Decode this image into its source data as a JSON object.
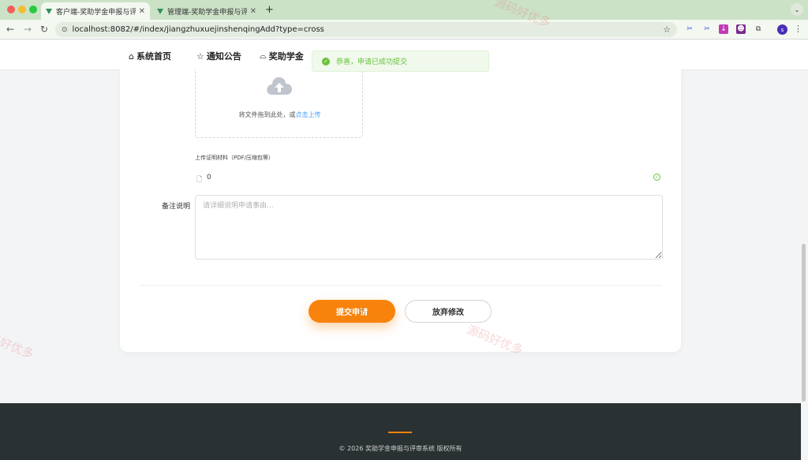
{
  "browser": {
    "tabs": [
      {
        "title": "客户端-奖助学金申报与评审系统",
        "active": true
      },
      {
        "title": "管理端-奖助学金申报与评审系统",
        "active": false
      }
    ],
    "url": "localhost:8082/#/index/jiangzhuxuejinshenqingAdd?type=cross",
    "profile_initial": "s"
  },
  "nav": {
    "items": [
      {
        "label": "系统首页",
        "icon": "home-icon"
      },
      {
        "label": "通知公告",
        "icon": "star-icon"
      },
      {
        "label": "奖助学金",
        "icon": "bag-icon"
      }
    ]
  },
  "toast": {
    "message": "恭喜，申请已成功提交",
    "type": "success"
  },
  "upload": {
    "hint": "将文件拖到此处，或",
    "link": "点击上传",
    "tip": "上传证明材料（PDF/压缩包等）",
    "file_name": "0"
  },
  "form": {
    "remark_label": "备注说明",
    "remark_placeholder": "请详细说明申请事由...",
    "remark_value": ""
  },
  "actions": {
    "submit_label": "提交申请",
    "cancel_label": "放弃修改"
  },
  "watermark": "源码好优多",
  "footer": {
    "text": "© 2026 奖助学金申报与评审系统 版权所有"
  },
  "colors": {
    "accent": "#f7830c",
    "success": "#67c23a",
    "link": "#409eff",
    "footer_bg": "#2a3133"
  }
}
